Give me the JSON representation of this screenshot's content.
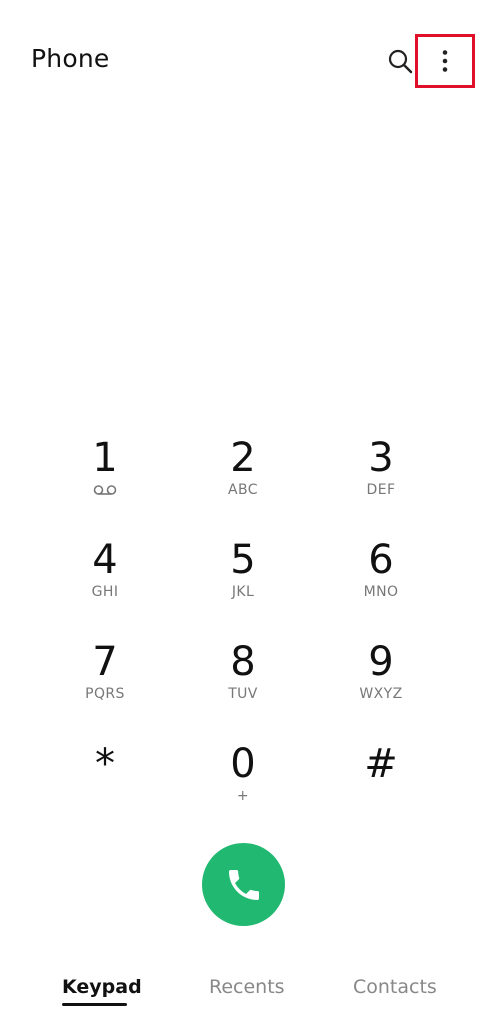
{
  "header": {
    "title": "Phone",
    "search_icon": "search-icon",
    "more_icon": "more-vertical-icon"
  },
  "keypad": {
    "keys": [
      {
        "digit": "1",
        "letters": "",
        "icon": "voicemail-icon"
      },
      {
        "digit": "2",
        "letters": "ABC"
      },
      {
        "digit": "3",
        "letters": "DEF"
      },
      {
        "digit": "4",
        "letters": "GHI"
      },
      {
        "digit": "5",
        "letters": "JKL"
      },
      {
        "digit": "6",
        "letters": "MNO"
      },
      {
        "digit": "7",
        "letters": "PQRS"
      },
      {
        "digit": "8",
        "letters": "TUV"
      },
      {
        "digit": "9",
        "letters": "WXYZ"
      },
      {
        "digit": "*",
        "letters": ""
      },
      {
        "digit": "0",
        "letters": "+"
      },
      {
        "digit": "#",
        "letters": ""
      }
    ]
  },
  "call": {
    "icon": "phone-icon",
    "color": "#21b971"
  },
  "tabs": [
    {
      "label": "Keypad",
      "active": true
    },
    {
      "label": "Recents",
      "active": false
    },
    {
      "label": "Contacts",
      "active": false
    }
  ],
  "colors": {
    "highlight_box": "#e0102a"
  }
}
